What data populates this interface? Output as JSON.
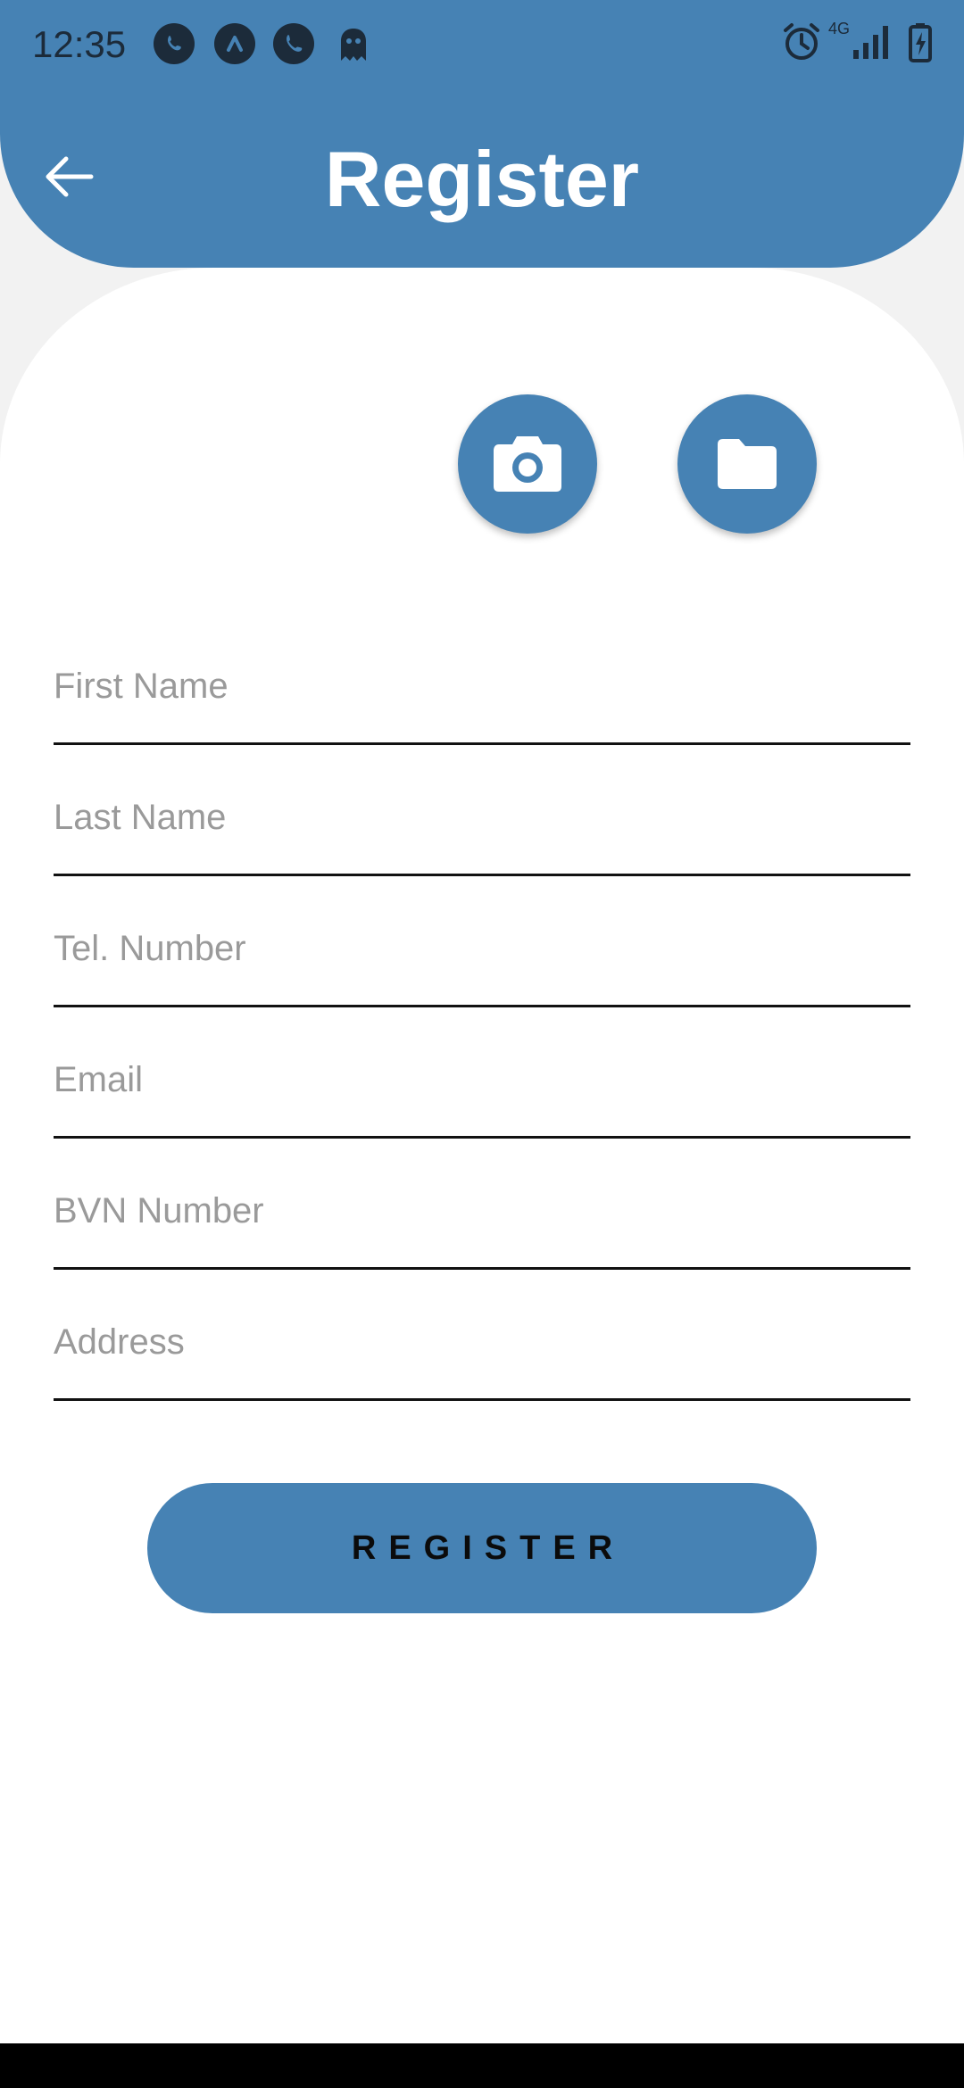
{
  "status_bar": {
    "time": "12:35",
    "network": "4G",
    "icons": [
      "whatsapp-icon",
      "arrow-up-icon",
      "phone-icon",
      "ghost-icon",
      "alarm-icon",
      "signal-icon",
      "battery-icon"
    ]
  },
  "header": {
    "title": "Register",
    "back_icon": "arrow-left-icon"
  },
  "media_buttons": {
    "camera_icon": "camera-icon",
    "folder_icon": "folder-icon"
  },
  "form": {
    "first_name_placeholder": "First Name",
    "last_name_placeholder": "Last Name",
    "tel_placeholder": "Tel. Number",
    "email_placeholder": "Email",
    "bvn_placeholder": "BVN Number",
    "address_placeholder": "Address",
    "submit_label": "REGISTER"
  },
  "colors": {
    "primary": "#4682b4",
    "background": "#f2f2f2",
    "card": "#ffffff",
    "status_icon": "#1c2b3a"
  }
}
